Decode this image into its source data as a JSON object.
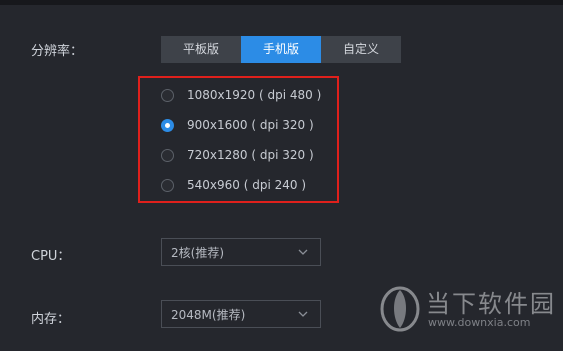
{
  "resolution": {
    "label": "分辨率：",
    "tabs": [
      {
        "label": "平板版",
        "active": false
      },
      {
        "label": "手机版",
        "active": true
      },
      {
        "label": "自定义",
        "active": false
      }
    ],
    "options": [
      {
        "label": "1080x1920 ( dpi 480 )",
        "checked": false
      },
      {
        "label": "900x1600 ( dpi 320 )",
        "checked": true
      },
      {
        "label": "720x1280 ( dpi 320 )",
        "checked": false
      },
      {
        "label": "540x960 ( dpi 240 )",
        "checked": false
      }
    ]
  },
  "cpu": {
    "label": "CPU：",
    "value": "2核(推荐)"
  },
  "memory": {
    "label": "内存：",
    "value": "2048M(推荐)"
  },
  "watermark": {
    "name": "当下软件园",
    "url": "www.downxia.com"
  },
  "colors": {
    "accent": "#2c8ce6",
    "highlight_border": "#e0201c",
    "background": "#25272d"
  }
}
